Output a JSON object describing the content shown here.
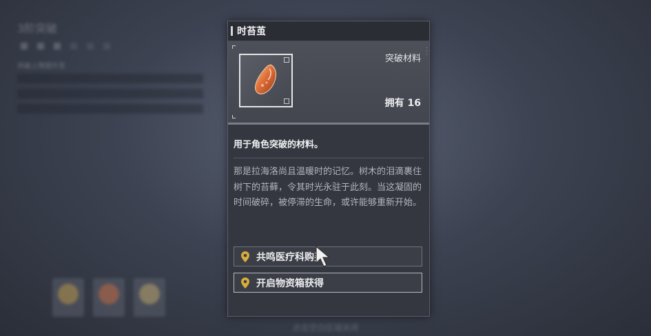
{
  "background": {
    "title": "3阶突破",
    "subtitle": "突破上限提升至",
    "hint": "点击空白区域关闭"
  },
  "item": {
    "name": "时苔茧",
    "category": "突破材料",
    "owned": "拥有 16",
    "short_desc": "用于角色突破的材料。",
    "long_desc": "那是拉海洛尚且温暖时的记忆。树木的泪滴裹住树下的苔藓，令其时光永驻于此刻。当这凝固的时间破碎，被停滞的生命，或许能够重新开始。",
    "sources": [
      {
        "label": "共鸣医疗科购买"
      },
      {
        "label": "开启物资箱获得"
      }
    ]
  },
  "colors": {
    "panel_bg": "#343740",
    "pin_gold": "#d9ad3a",
    "gem_orange": "#e0703a"
  }
}
